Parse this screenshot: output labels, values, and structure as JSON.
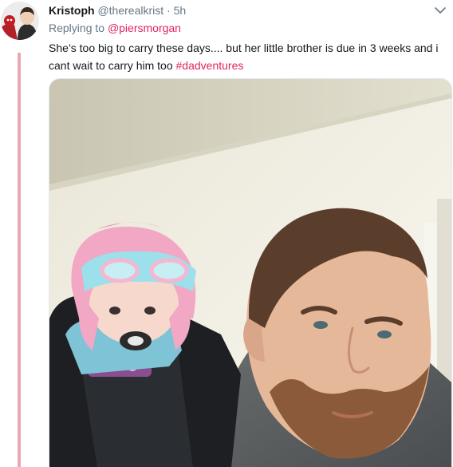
{
  "tweet": {
    "display_name": "Kristoph",
    "handle": "@therealkrist",
    "separator": "·",
    "time": "5h",
    "reply_prefix": "Replying to",
    "reply_mention": "@piersmorgan",
    "text": "She’s too big to carry these days.... but her little brother is due in 3 weeks and i cant wait to carry him too",
    "hashtag": "#dadventures"
  },
  "icons": {
    "more": "chevron-down-icon"
  },
  "colors": {
    "accent": "#e0245e",
    "thread_line": "#e8a9b3",
    "text_primary": "#14171a",
    "text_secondary": "#657786"
  }
}
